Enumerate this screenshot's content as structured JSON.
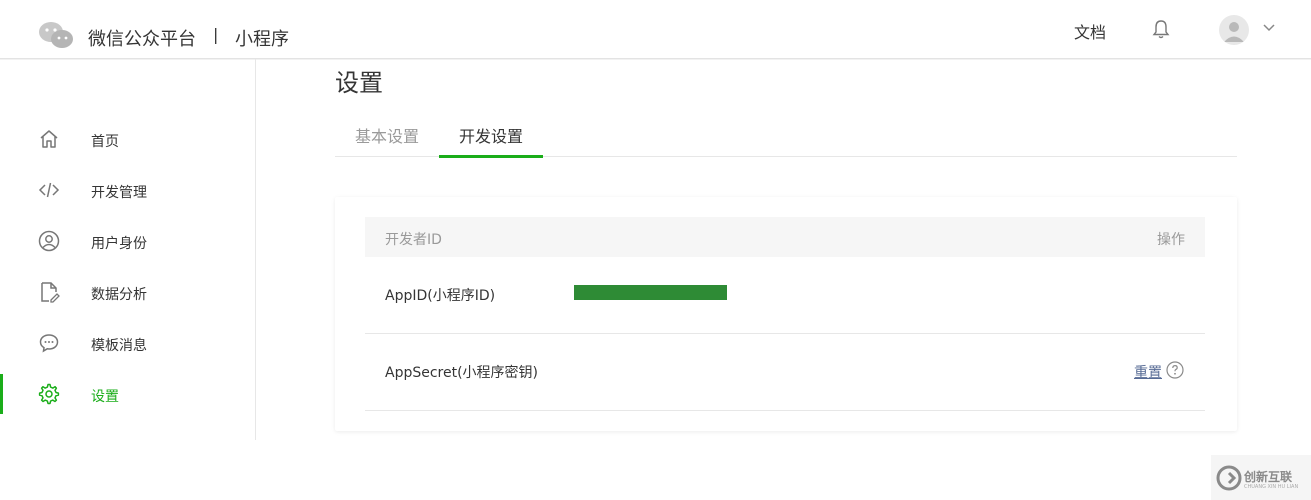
{
  "header": {
    "brand": "微信公众平台",
    "separator": "|",
    "product": "小程序",
    "docs_label": "文档",
    "icons": [
      "wechat-logo-icon",
      "bell-icon",
      "avatar-icon",
      "chevron-down-icon"
    ]
  },
  "sidebar": {
    "items": [
      {
        "label": "首页",
        "icon": "home-icon",
        "active": false
      },
      {
        "label": "开发管理",
        "icon": "code-icon",
        "active": false
      },
      {
        "label": "用户身份",
        "icon": "user-icon",
        "active": false
      },
      {
        "label": "数据分析",
        "icon": "data-file-icon",
        "active": false
      },
      {
        "label": "模板消息",
        "icon": "message-icon",
        "active": false
      },
      {
        "label": "设置",
        "icon": "gear-icon",
        "active": true
      }
    ],
    "accent_color": "#1aad19"
  },
  "main": {
    "title": "设置",
    "tabs": [
      {
        "label": "基本设置",
        "active": false
      },
      {
        "label": "开发设置",
        "active": true
      }
    ],
    "table": {
      "header_left": "开发者ID",
      "header_right": "操作",
      "rows": [
        {
          "label": "AppID(小程序ID)",
          "value_redacted": true,
          "action": ""
        },
        {
          "label": "AppSecret(小程序密钥)",
          "action": "重置",
          "action_icon": "help-icon"
        }
      ]
    }
  },
  "watermark": {
    "text": "创新互联",
    "subtext": "CHUANG XIN HU LIAN"
  }
}
